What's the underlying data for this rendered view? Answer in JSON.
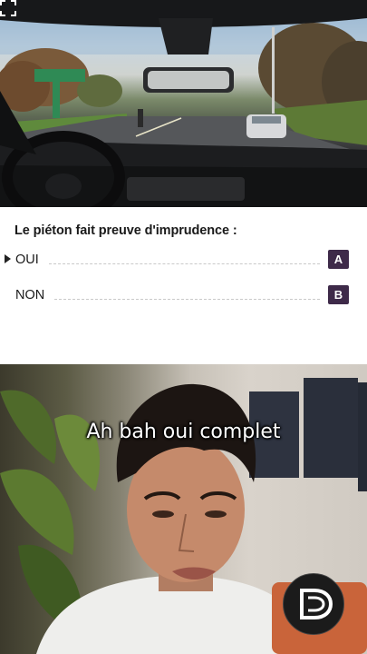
{
  "quiz": {
    "question": "Le piéton fait preuve d'imprudence :",
    "options": [
      {
        "label": "OUI",
        "letter": "A",
        "selected": true
      },
      {
        "label": "NON",
        "letter": "B",
        "selected": false
      }
    ]
  },
  "caption": "Ah bah oui complet",
  "colors": {
    "answer_badge": "#3e2a49"
  },
  "icons": {
    "fullscreen": "fullscreen-icon",
    "selection": "triangle-right-icon",
    "channel_logo": "channel-logo-icon"
  }
}
